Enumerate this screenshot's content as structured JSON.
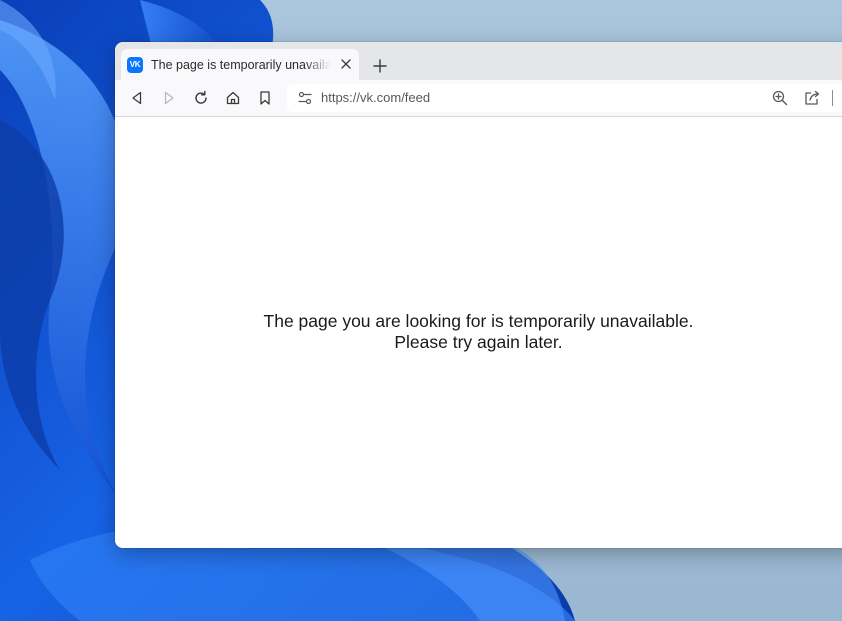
{
  "browser": {
    "tab": {
      "title": "The page is temporarily unavailable",
      "favicon_text": "VK",
      "favicon_color": "#0b77ff"
    },
    "toolbar": {
      "url": "https://vk.com/feed"
    }
  },
  "page": {
    "message_line1": "The page you are looking for is temporarily unavailable.",
    "message_line2": "Please try again later."
  },
  "icons": {
    "tab_close": "close-icon",
    "new_tab": "plus-icon",
    "back": "back-arrow-icon",
    "forward": "forward-arrow-icon",
    "reload": "reload-icon",
    "home": "home-icon",
    "bookmark": "bookmark-icon",
    "site_info": "site-settings-icon",
    "zoom": "zoom-in-icon",
    "share": "share-icon"
  },
  "colors": {
    "wallpaper_sky": "#a9c4dc",
    "wallpaper_bloom": "#1a5bd6",
    "tabbar": "#e5e6e8",
    "toolbar": "#f9f9fb"
  }
}
